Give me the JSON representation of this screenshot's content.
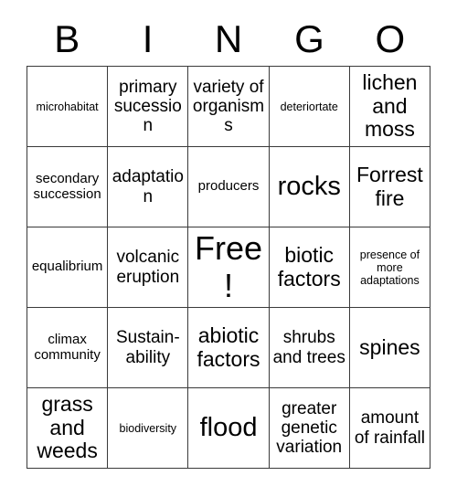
{
  "card": {
    "header_letters": [
      "B",
      "I",
      "N",
      "G",
      "O"
    ],
    "columns": 5,
    "rows": 5,
    "border_color": "#3a3a3a",
    "background_color": "#ffffff",
    "text_color": "#000000",
    "cells": [
      [
        {
          "text": "microhabitat",
          "size": "xs"
        },
        {
          "text": "primary sucession",
          "size": "md"
        },
        {
          "text": "variety of organisms",
          "size": "md"
        },
        {
          "text": "deteriortate",
          "size": "xs"
        },
        {
          "text": "lichen and moss",
          "size": "lg"
        }
      ],
      [
        {
          "text": "secondary succession",
          "size": "sm"
        },
        {
          "text": "adaptation",
          "size": "md"
        },
        {
          "text": "producers",
          "size": "sm"
        },
        {
          "text": "rocks",
          "size": "xl"
        },
        {
          "text": "Forrest fire",
          "size": "lg"
        }
      ],
      [
        {
          "text": "equalibrium",
          "size": "sm"
        },
        {
          "text": "volcanic eruption",
          "size": "md"
        },
        {
          "text": "Free!",
          "size": "xxl"
        },
        {
          "text": "biotic factors",
          "size": "lg"
        },
        {
          "text": "presence of more adaptations",
          "size": "xs"
        }
      ],
      [
        {
          "text": "climax community",
          "size": "sm"
        },
        {
          "text": "Sustain- ability",
          "size": "md"
        },
        {
          "text": "abiotic factors",
          "size": "lg"
        },
        {
          "text": "shrubs and trees",
          "size": "md"
        },
        {
          "text": "spines",
          "size": "lg"
        }
      ],
      [
        {
          "text": "grass and weeds",
          "size": "lg"
        },
        {
          "text": "biodiversity",
          "size": "xs"
        },
        {
          "text": "flood",
          "size": "xl"
        },
        {
          "text": "greater genetic variation",
          "size": "md"
        },
        {
          "text": "amount of rainfall",
          "size": "md"
        }
      ]
    ]
  }
}
